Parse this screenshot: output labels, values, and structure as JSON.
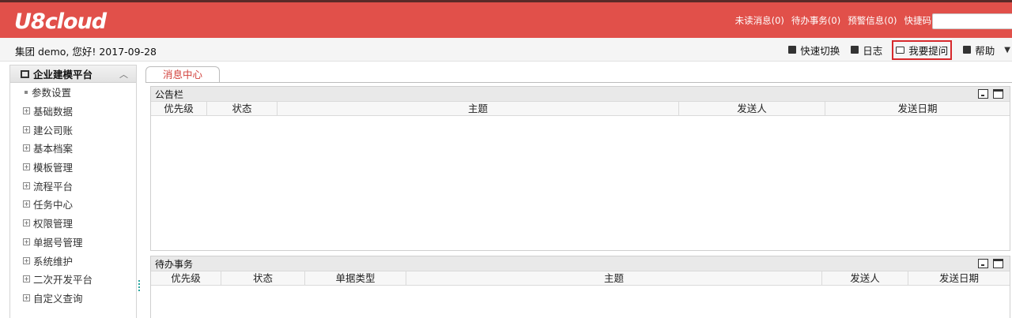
{
  "app": {
    "logo": "U8cloud"
  },
  "toplinks": [
    {
      "label": "未读消息(0)"
    },
    {
      "label": "待办事务(0)"
    },
    {
      "label": "预警信息(0)"
    },
    {
      "label": "快捷码"
    }
  ],
  "quickcode": {
    "value": ""
  },
  "greeting": "集团 demo, 您好! 2017-09-28",
  "subtools": [
    {
      "label": "快速切换",
      "icon": "switch-icon"
    },
    {
      "label": "日志",
      "icon": "log-icon"
    },
    {
      "label": "我要提问",
      "icon": "question-icon"
    },
    {
      "label": "帮助",
      "icon": "help-icon"
    }
  ],
  "sidebar": {
    "title": "企业建模平台",
    "items": [
      {
        "label": "参数设置"
      },
      {
        "label": "基础数据"
      },
      {
        "label": "建公司账"
      },
      {
        "label": "基本档案"
      },
      {
        "label": "模板管理"
      },
      {
        "label": "流程平台"
      },
      {
        "label": "任务中心"
      },
      {
        "label": "权限管理"
      },
      {
        "label": "单据号管理"
      },
      {
        "label": "系统维护"
      },
      {
        "label": "二次开发平台"
      },
      {
        "label": "自定义查询"
      }
    ]
  },
  "tabs": [
    {
      "label": "消息中心"
    }
  ],
  "panels": {
    "notice": {
      "title": "公告栏",
      "columns": [
        "优先级",
        "状态",
        "主题",
        "发送人",
        "发送日期"
      ]
    },
    "todo": {
      "title": "待办事务",
      "columns": [
        "优先级",
        "状态",
        "单据类型",
        "主题",
        "发送人",
        "发送日期"
      ]
    }
  },
  "colors": {
    "brand": "#e1504a",
    "tab_active": "#d2413c",
    "highlight_border": "#d7292c"
  }
}
